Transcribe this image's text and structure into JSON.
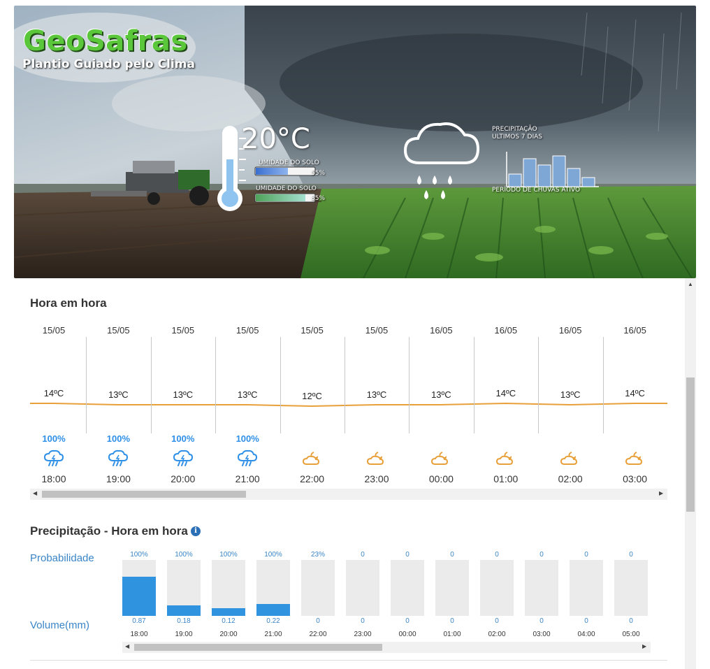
{
  "banner": {
    "title": "GeoSafras",
    "subtitle": "Plantio Guiado pelo Clima",
    "temperature": "20°C",
    "soil_label_1": "UMIDADE DO SOLO",
    "soil_value_1": "55%",
    "soil_level_1": 0.55,
    "soil_label_2": "UMIDADE DO SOLO",
    "soil_value_2": "85%",
    "soil_level_2": 0.85,
    "precip_title_1": "PRECIPITAÇÃO",
    "precip_title_2": "ULTIMOS 7 DIAS",
    "precip_bars": [
      0.4,
      0.9,
      0.7,
      1.0,
      0.6,
      0.3
    ],
    "rain_period": "PERÍODO DE CHUVAS ATIVO"
  },
  "hourly": {
    "title": "Hora em hora",
    "items": [
      {
        "date": "15/05",
        "temp": "14ºC",
        "temp_value": 14,
        "prob": "100%",
        "icon": "rain-cloud-icon",
        "time": "18:00"
      },
      {
        "date": "15/05",
        "temp": "13ºC",
        "temp_value": 13,
        "prob": "100%",
        "icon": "rain-cloud-icon",
        "time": "19:00"
      },
      {
        "date": "15/05",
        "temp": "13ºC",
        "temp_value": 13,
        "prob": "100%",
        "icon": "rain-cloud-icon",
        "time": "20:00"
      },
      {
        "date": "15/05",
        "temp": "13ºC",
        "temp_value": 13,
        "prob": "100%",
        "icon": "rain-cloud-icon",
        "time": "21:00"
      },
      {
        "date": "15/05",
        "temp": "12ºC",
        "temp_value": 12,
        "prob": "",
        "icon": "cloudy-night-icon",
        "time": "22:00"
      },
      {
        "date": "15/05",
        "temp": "13ºC",
        "temp_value": 13,
        "prob": "",
        "icon": "cloudy-night-icon",
        "time": "23:00"
      },
      {
        "date": "16/05",
        "temp": "13ºC",
        "temp_value": 13,
        "prob": "",
        "icon": "cloudy-night-icon",
        "time": "00:00"
      },
      {
        "date": "16/05",
        "temp": "14ºC",
        "temp_value": 14,
        "prob": "",
        "icon": "cloudy-night-icon",
        "time": "01:00"
      },
      {
        "date": "16/05",
        "temp": "13ºC",
        "temp_value": 13,
        "prob": "",
        "icon": "cloudy-night-icon",
        "time": "02:00"
      },
      {
        "date": "16/05",
        "temp": "14ºC",
        "temp_value": 14,
        "prob": "",
        "icon": "cloudy-night-icon",
        "time": "03:00"
      }
    ],
    "colors": {
      "line": "#e8a03a",
      "prob": "#2e8fe6",
      "night_icon": "#e8a03a",
      "rain_icon": "#2e8fe6"
    }
  },
  "precip": {
    "title": "Precipitação - Hora em hora",
    "prob_label": "Probabilidade",
    "vol_label": "Volume(mm)",
    "items": [
      {
        "prob": "100%",
        "vol": "0.87",
        "time": "18:00",
        "level": 0.87
      },
      {
        "prob": "100%",
        "vol": "0.18",
        "time": "19:00",
        "level": 0.18
      },
      {
        "prob": "100%",
        "vol": "0.12",
        "time": "20:00",
        "level": 0.12
      },
      {
        "prob": "100%",
        "vol": "0.22",
        "time": "21:00",
        "level": 0.22
      },
      {
        "prob": "23%",
        "vol": "0",
        "time": "22:00",
        "level": 0
      },
      {
        "prob": "0",
        "vol": "0",
        "time": "23:00",
        "level": 0
      },
      {
        "prob": "0",
        "vol": "0",
        "time": "00:00",
        "level": 0
      },
      {
        "prob": "0",
        "vol": "0",
        "time": "01:00",
        "level": 0
      },
      {
        "prob": "0",
        "vol": "0",
        "time": "02:00",
        "level": 0
      },
      {
        "prob": "0",
        "vol": "0",
        "time": "03:00",
        "level": 0
      },
      {
        "prob": "0",
        "vol": "0",
        "time": "04:00",
        "level": 0
      },
      {
        "prob": "0",
        "vol": "0",
        "time": "05:00",
        "level": 0
      }
    ],
    "colors": {
      "fill": "#2f93e0",
      "empty": "#ebebeb"
    }
  }
}
